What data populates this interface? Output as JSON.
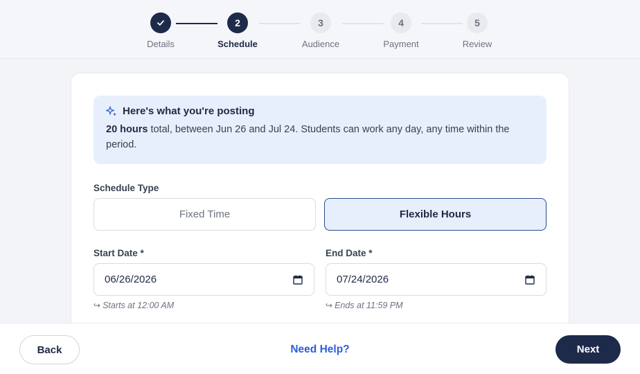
{
  "stepper": {
    "steps": [
      {
        "number": "1",
        "label": "Details",
        "state": "done"
      },
      {
        "number": "2",
        "label": "Schedule",
        "state": "active"
      },
      {
        "number": "3",
        "label": "Audience",
        "state": "pending"
      },
      {
        "number": "4",
        "label": "Payment",
        "state": "pending"
      },
      {
        "number": "5",
        "label": "Review",
        "state": "pending"
      }
    ]
  },
  "summary": {
    "title": "Here's what you're posting",
    "hours": "20 hours",
    "text": " total, between Jun 26 and Jul 24. Students can work any day, any time within the period."
  },
  "schedule": {
    "type_label": "Schedule Type",
    "options": [
      "Fixed Time",
      "Flexible Hours"
    ],
    "selected": "Flexible Hours"
  },
  "dates": {
    "start_label": "Start Date *",
    "start_value": "06/26/2026",
    "start_hint": "Starts at 12:00 AM",
    "end_label": "End Date *",
    "end_value": "07/24/2026",
    "end_hint": "Ends at 11:59 PM"
  },
  "footer": {
    "back_label": "Back",
    "help_label": "Need Help?",
    "next_label": "Next"
  },
  "colors": {
    "primary": "#1e2a4a",
    "accent": "#2b5fd9",
    "info_bg": "#e8effc"
  }
}
